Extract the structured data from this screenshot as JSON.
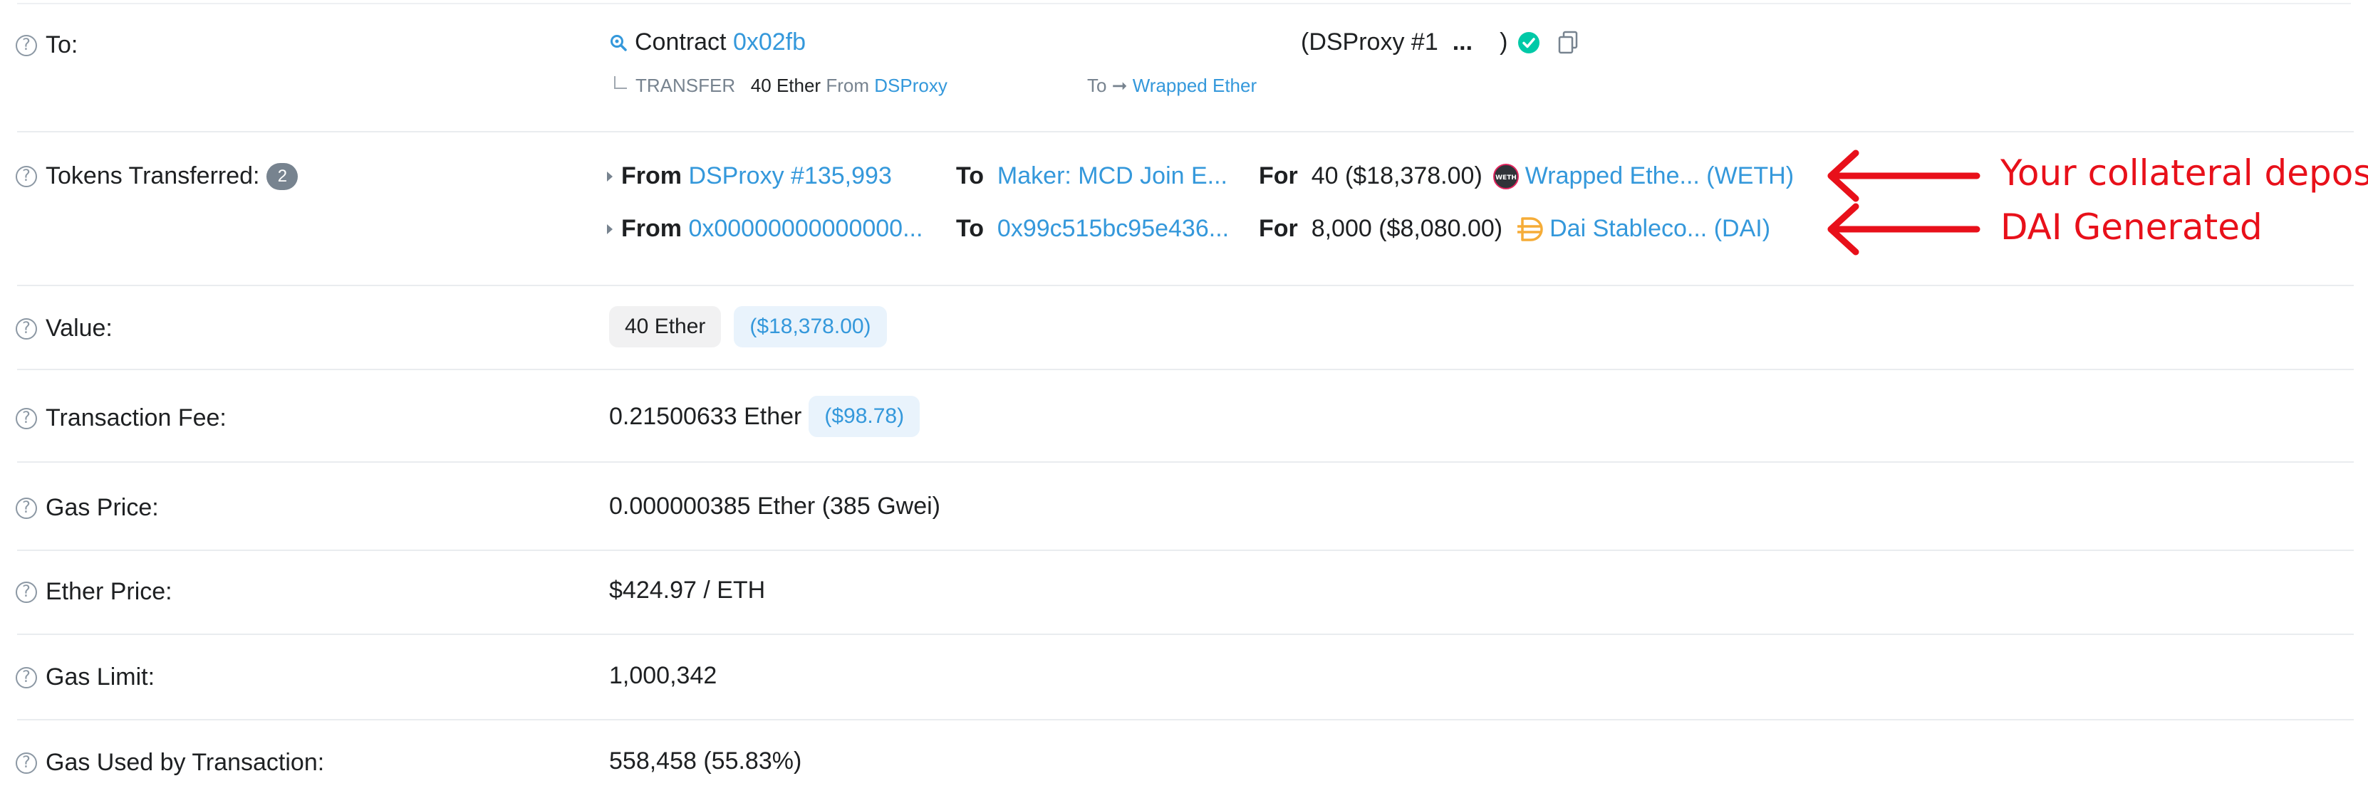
{
  "to": {
    "label": "To:",
    "contract_prefix": "Contract",
    "contract_addr": "0x02fb",
    "name_open": "(DSProxy #1",
    "ellipsis": "...",
    "name_close": ")",
    "transfer_label": "TRANSFER",
    "transfer_amount": "40 Ether",
    "transfer_from_label": "From",
    "transfer_from": "DSProxy",
    "transfer_to_label": "To",
    "transfer_to": "Wrapped Ether"
  },
  "tokens": {
    "label": "Tokens Transferred:",
    "count": "2",
    "from_label": "From",
    "to_label": "To",
    "for_label": "For",
    "rows": [
      {
        "from": "DSProxy #135,993",
        "to": "Maker: MCD Join E...",
        "amount": "40 ($18,378.00)",
        "token": "Wrapped Ethe... (WETH)",
        "token_logo": "WETH"
      },
      {
        "from": "0x00000000000000...",
        "to": "0x99c515bc95e436...",
        "amount": "8,000 ($8,080.00)",
        "token": "Dai Stableco... (DAI)"
      }
    ]
  },
  "annotations": [
    "Your collateral deposit",
    "DAI Generated"
  ],
  "value": {
    "label": "Value:",
    "ether": "40 Ether",
    "usd": "($18,378.00)"
  },
  "fee": {
    "label": "Transaction Fee:",
    "value": "0.21500633 Ether",
    "usd": "($98.78)"
  },
  "gas_price": {
    "label": "Gas Price:",
    "value": "0.000000385 Ether (385 Gwei)"
  },
  "ether_price": {
    "label": "Ether Price:",
    "value": "$424.97 / ETH"
  },
  "gas_limit": {
    "label": "Gas Limit:",
    "value": "1,000,342"
  },
  "gas_used": {
    "label": "Gas Used by Transaction:",
    "value": "558,458 (55.83%)"
  },
  "colors": {
    "link": "#3498db",
    "verified": "#00c9a7",
    "annotation": "#e8101a",
    "dai": "#f5ac37"
  }
}
